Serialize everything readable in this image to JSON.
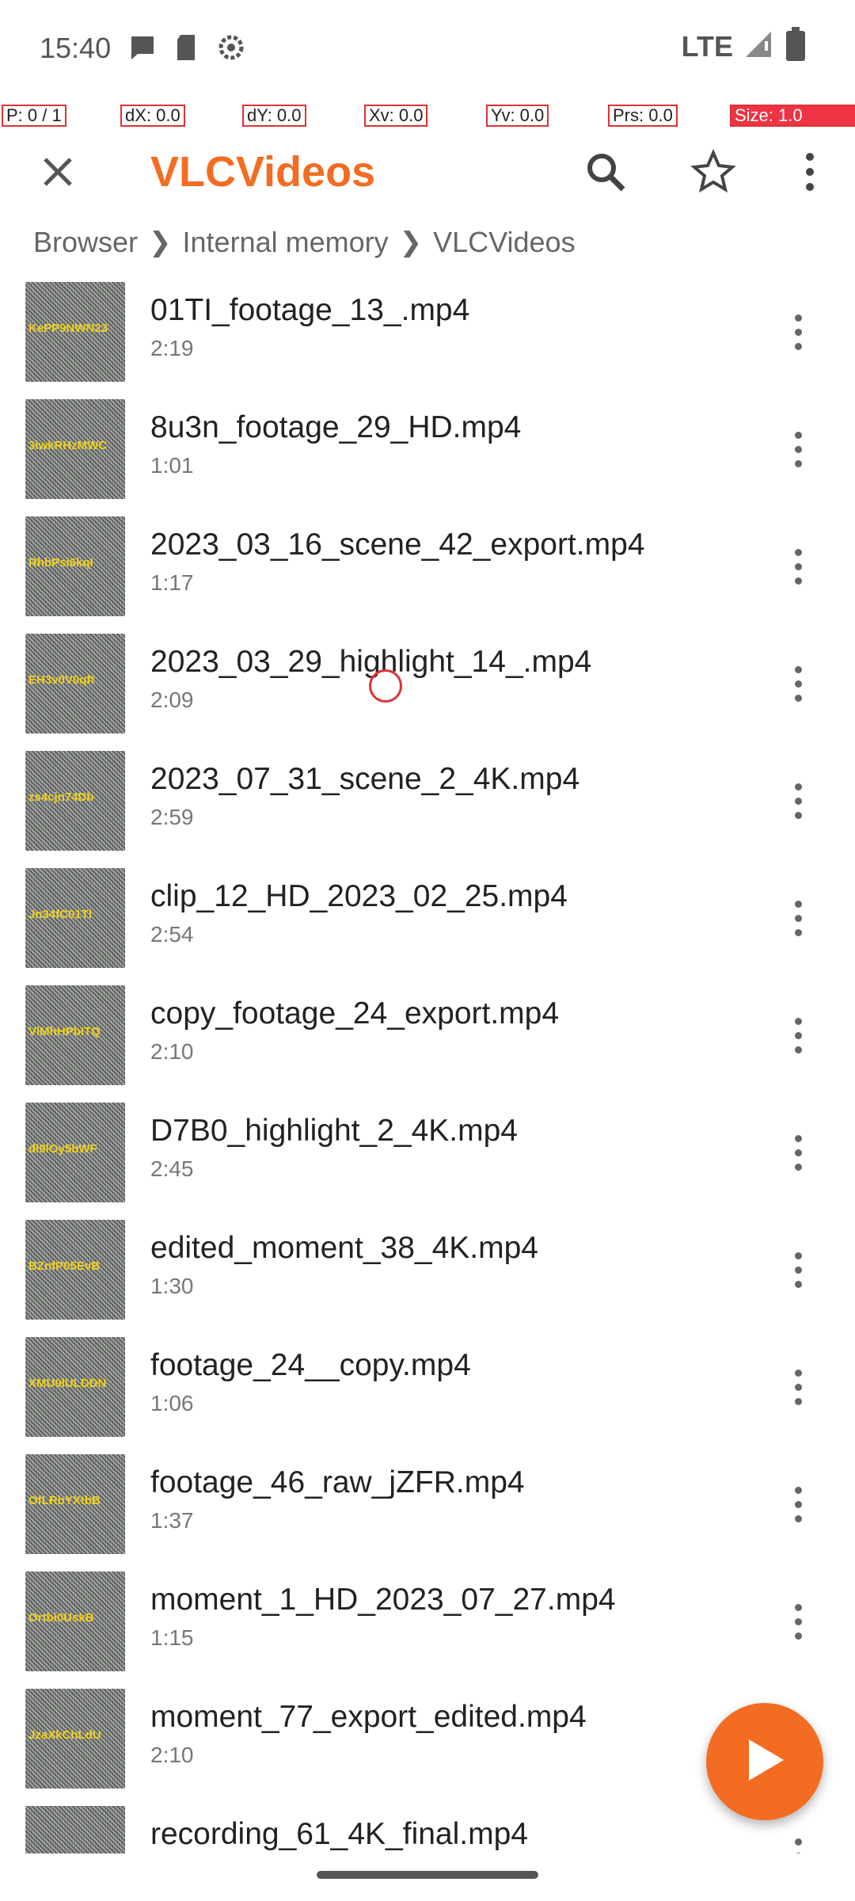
{
  "status_bar": {
    "time": "15:40",
    "network": "LTE",
    "icons": [
      "message-icon",
      "sd-card-icon",
      "settings-icon",
      "signal-icon",
      "battery-icon"
    ]
  },
  "pointer_overlay": {
    "p": "P: 0 / 1",
    "dx": "dX: 0.0",
    "dy": "dY: 0.0",
    "xv": "Xv: 0.0",
    "yv": "Yv: 0.0",
    "prs": "Prs: 0.0",
    "size": "Size: 1.0"
  },
  "toolbar": {
    "title": "VLCVideos",
    "actions": [
      "close-icon",
      "search-icon",
      "star-icon",
      "more-vert-icon"
    ]
  },
  "breadcrumb": [
    "Browser",
    "Internal memory",
    "VLCVideos"
  ],
  "files": [
    {
      "name": "01TI_footage_13_.mp4",
      "duration": "2:19",
      "thumb": "KePP9NWN23"
    },
    {
      "name": "8u3n_footage_29_HD.mp4",
      "duration": "1:01",
      "thumb": "3iwkRHzMWC"
    },
    {
      "name": "2023_03_16_scene_42_export.mp4",
      "duration": "1:17",
      "thumb": "RhbPsi6kqI"
    },
    {
      "name": "2023_03_29_highlight_14_.mp4",
      "duration": "2:09",
      "thumb": "EH3v0V0qft"
    },
    {
      "name": "2023_07_31_scene_2_4K.mp4",
      "duration": "2:59",
      "thumb": "zs4cjn74Db"
    },
    {
      "name": "clip_12_HD_2023_02_25.mp4",
      "duration": "2:54",
      "thumb": "Jn34fC01Tl"
    },
    {
      "name": "copy_footage_24_export.mp4",
      "duration": "2:10",
      "thumb": "VlMhHPbITQ"
    },
    {
      "name": "D7B0_highlight_2_4K.mp4",
      "duration": "2:45",
      "thumb": "dl9lOy5bWF"
    },
    {
      "name": "edited_moment_38_4K.mp4",
      "duration": "1:30",
      "thumb": "BZnfP05EvB"
    },
    {
      "name": "footage_24__copy.mp4",
      "duration": "1:06",
      "thumb": "XMU0lULDDN"
    },
    {
      "name": "footage_46_raw_jZFR.mp4",
      "duration": "1:37",
      "thumb": "OfLRbYXtbB"
    },
    {
      "name": "moment_1_HD_2023_07_27.mp4",
      "duration": "1:15",
      "thumb": "Ortbi0UskB"
    },
    {
      "name": "moment_77_export_edited.mp4",
      "duration": "2:10",
      "thumb": "JzaXkChLdU"
    },
    {
      "name": "recording_61_4K_final.mp4",
      "duration": "",
      "thumb": ""
    }
  ],
  "colors": {
    "accent": "#f36c21",
    "text_primary": "#222222",
    "text_secondary": "#777777"
  }
}
